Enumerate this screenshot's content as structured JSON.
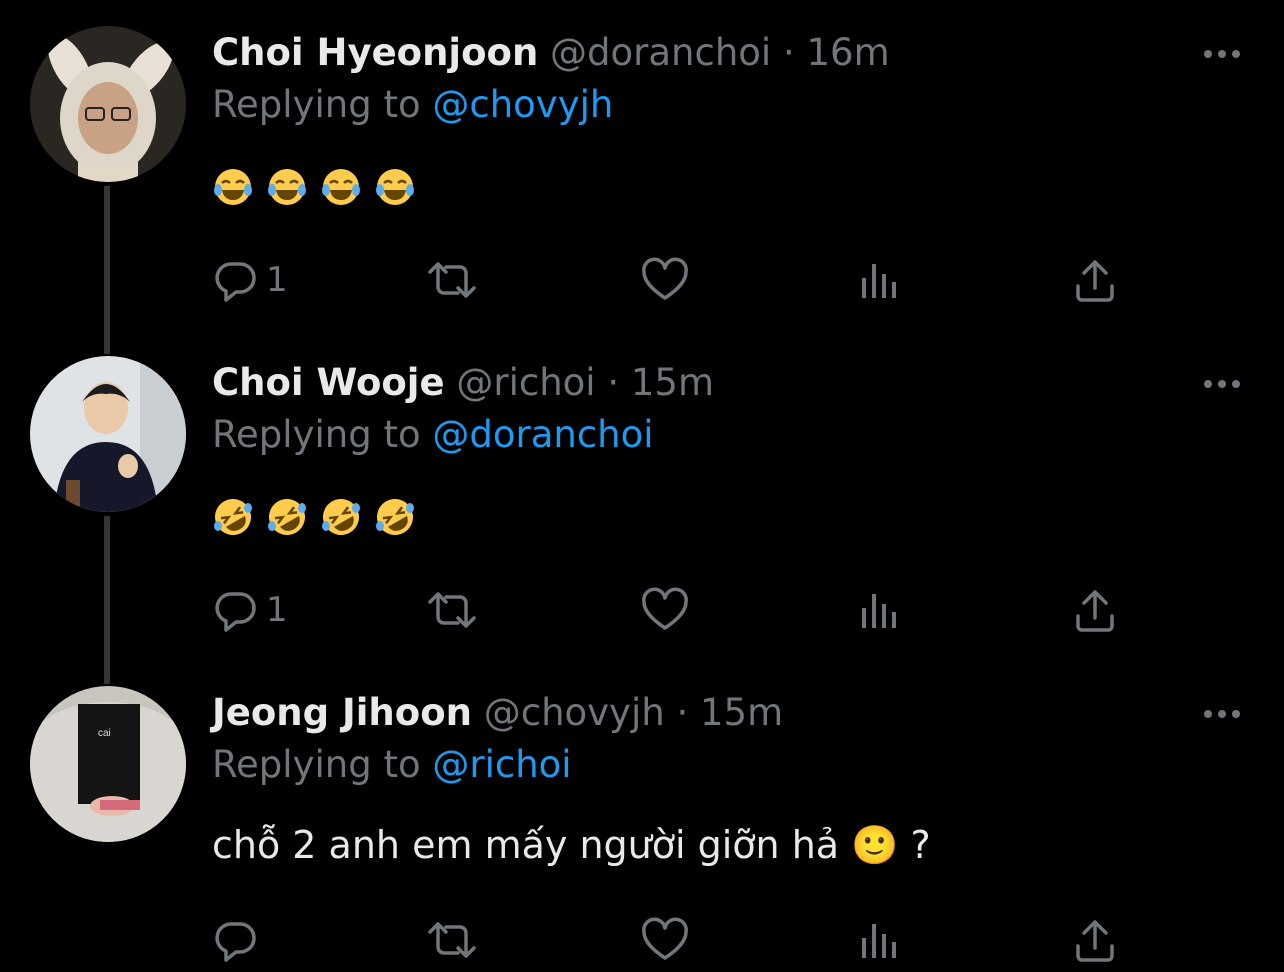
{
  "tweets": [
    {
      "display_name": "Choi Hyeonjoon",
      "handle": "@doranchoi",
      "separator": "·",
      "time": "16m",
      "replying_prefix": "Replying to",
      "replying_handle": "@chovyjh",
      "content_emojis": [
        "😂",
        "😂",
        "😂",
        "😂"
      ],
      "content_text": "",
      "reply_count": "1",
      "avatar": "bunny-hat-avatar"
    },
    {
      "display_name": "Choi Wooje",
      "handle": "@richoi",
      "separator": "·",
      "time": "15m",
      "replying_prefix": "Replying to",
      "replying_handle": "@doranchoi",
      "content_emojis": [
        "🤣",
        "🤣",
        "🤣",
        "🤣"
      ],
      "content_text": "",
      "reply_count": "1",
      "avatar": "thumbs-up-avatar"
    },
    {
      "display_name": "Jeong Jihoon",
      "handle": "@chovyjh",
      "separator": "·",
      "time": "15m",
      "replying_prefix": "Replying to",
      "replying_handle": "@richoi",
      "content_emojis": [],
      "content_text": "chỗ 2 anh em mấy người giỡn hả 🙂 ?",
      "reply_count": "",
      "avatar": "jacket-avatar"
    }
  ],
  "colors": {
    "background": "#000000",
    "primary_text": "#e7e9ea",
    "secondary_text": "#71767b",
    "link": "#1d9bf0",
    "thread_line": "#333639"
  },
  "icons": [
    "reply-icon",
    "retweet-icon",
    "like-icon",
    "analytics-icon",
    "share-icon",
    "more-icon"
  ]
}
